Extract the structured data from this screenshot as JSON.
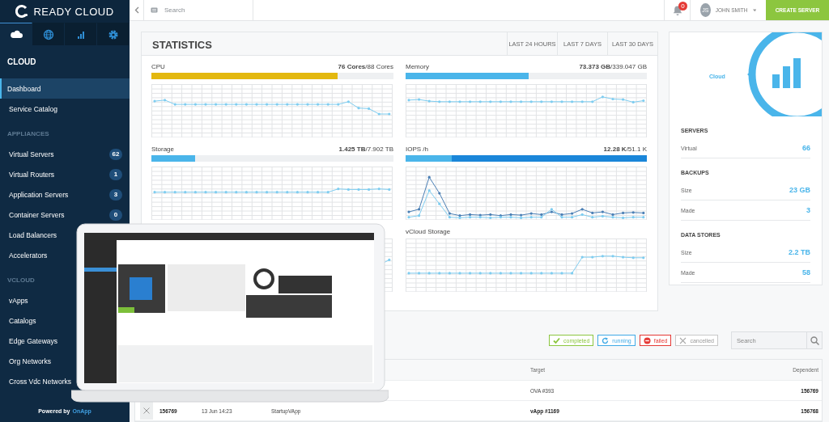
{
  "sidebar": {
    "logo": "READY CLOUD",
    "tabs": [
      {
        "kind": "cloud",
        "selected": true
      },
      {
        "kind": "globe",
        "selected": false
      },
      {
        "kind": "chart",
        "selected": false
      },
      {
        "kind": "settings",
        "selected": false
      }
    ],
    "heading": "CLOUD",
    "sections": [
      {
        "items": [
          {
            "label": "Dashboard",
            "selected": true
          },
          {
            "label": "Service Catalog",
            "selected": false
          }
        ]
      },
      {
        "title": "APPLIANCES",
        "items": [
          {
            "label": "Virtual Servers",
            "selected": false,
            "count": "62"
          },
          {
            "label": "Virtual Routers",
            "selected": false,
            "count": "1"
          },
          {
            "label": "Application Servers",
            "selected": false,
            "count": "3"
          },
          {
            "label": "Container Servers",
            "selected": false,
            "count": "0"
          },
          {
            "label": "Load Balancers",
            "selected": false
          },
          {
            "label": "Accelerators",
            "selected": false
          }
        ]
      },
      {
        "title": "VCLOUD",
        "items": [
          {
            "label": "vApps",
            "selected": false
          },
          {
            "label": "Catalogs",
            "selected": false
          },
          {
            "label": "Edge Gateways",
            "selected": false
          },
          {
            "label": "Org Networks",
            "selected": false
          },
          {
            "label": "Cross Vdc Networks",
            "selected": false
          }
        ]
      }
    ],
    "footer_text": "Powered by",
    "footer_link": "OnApp"
  },
  "topbar": {
    "search_placeholder": "Search",
    "notifications": "0",
    "user_initials": "JS",
    "user_name": "JOHN SMITH",
    "create_button": "CREATE SERVER"
  },
  "stats": {
    "title": "STATISTICS",
    "ranges": [
      "LAST 24 HOURS",
      "LAST 7 DAYS",
      "LAST 30 DAYS"
    ],
    "panels": [
      {
        "kind": "meter",
        "label": "CPU",
        "reading": "**76 Cores**/88 Cores",
        "meter": {
          "kind": "plain",
          "level": 0.77,
          "color": "#e3b80f"
        }
      },
      {
        "kind": "meter",
        "label": "Memory",
        "reading": "**73.373 GB**/339.047 GB",
        "meter": {
          "kind": "plain",
          "level": 0.51,
          "color": "#4ab5ea"
        }
      },
      {
        "kind": "meter",
        "label": "Storage",
        "reading": "**1.425 TB**/7.902 TB",
        "meter": {
          "kind": "plain",
          "level": 0.18,
          "color": "#4ab5ea"
        }
      },
      {
        "kind": "meter",
        "label": "IOPS /h",
        "reading": "**12.28 K**/51.1 K",
        "meter": {
          "kind": "split",
          "level": 0.19,
          "color": "#4ab5ea"
        }
      },
      {
        "kind": "chart"
      },
      {
        "kind": "chart",
        "label": "vCloud Storage"
      }
    ]
  },
  "summary": {
    "label": "Cloud",
    "groups": [
      {
        "title": "SERVERS",
        "rows": [
          {
            "label": "Virtual",
            "value": "66"
          }
        ]
      },
      {
        "title": "BACKUPS",
        "rows": [
          {
            "label": "Size",
            "value": "23 GB"
          },
          {
            "label": "Made",
            "value": "3"
          }
        ]
      },
      {
        "title": "DATA STORES",
        "rows": [
          {
            "label": "Size",
            "value": "2.2 TB"
          },
          {
            "label": "Made",
            "value": "58"
          }
        ]
      }
    ]
  },
  "activity": {
    "filters": [
      {
        "kind": "completed",
        "label": "completed",
        "color": "#8cc63f"
      },
      {
        "kind": "running",
        "label": "running",
        "color": "#3fa9e6"
      },
      {
        "kind": "failed",
        "label": "failed",
        "color": "#e53935"
      },
      {
        "kind": "cancelled",
        "label": "cancelled",
        "color": "#c8c8c8"
      }
    ],
    "search_placeholder": "Search",
    "columns": [
      "Target",
      "Dependent"
    ],
    "rows": [
      {
        "target": "OVA #393",
        "target_bold": false,
        "dependent": "156769"
      },
      {
        "cancelled": true,
        "id": "156769",
        "date": "13 Jun 14:23",
        "action": "StartupVApp",
        "target": "vApp #1169",
        "target_bold": true,
        "dependent": "156768"
      }
    ]
  }
}
